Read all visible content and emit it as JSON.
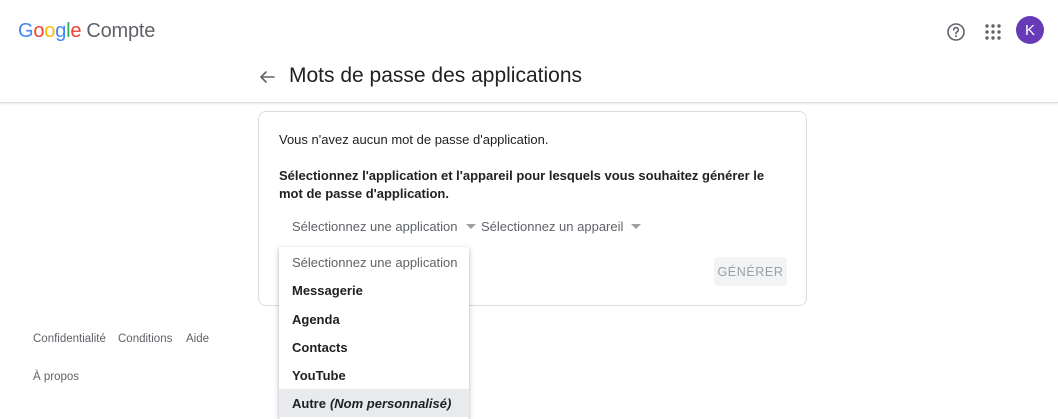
{
  "header": {
    "logo_google": "Google",
    "logo_product": "Compte",
    "avatar_letter": "K",
    "help_icon": "help-circle-icon",
    "apps_icon": "apps-grid-icon"
  },
  "page": {
    "back_icon": "arrow-back-icon",
    "title": "Mots de passe des applications"
  },
  "card": {
    "no_password_text": "Vous n'avez aucun mot de passe d'application.",
    "instruction_text": "Sélectionnez l'application et l'appareil pour lesquels vous souhaitez générer le mot de passe d'application.",
    "app_select_label": "Sélectionnez une application",
    "device_select_label": "Sélectionnez un appareil",
    "generate_label": "GÉNÉRER"
  },
  "dropdown": {
    "header_label": "Sélectionnez une application",
    "items": [
      {
        "label": "Messagerie"
      },
      {
        "label": "Agenda"
      },
      {
        "label": "Contacts"
      },
      {
        "label": "YouTube"
      },
      {
        "label": "Autre",
        "suffix": "(Nom personnalisé)"
      }
    ]
  },
  "footer": {
    "links": [
      "Confidentialité",
      "Conditions",
      "Aide"
    ],
    "about": "À propos"
  },
  "colors": {
    "avatar_bg": "#673ab7",
    "text_primary": "#202124",
    "text_secondary": "#5f6368",
    "selected_bg": "#e8eaed"
  }
}
